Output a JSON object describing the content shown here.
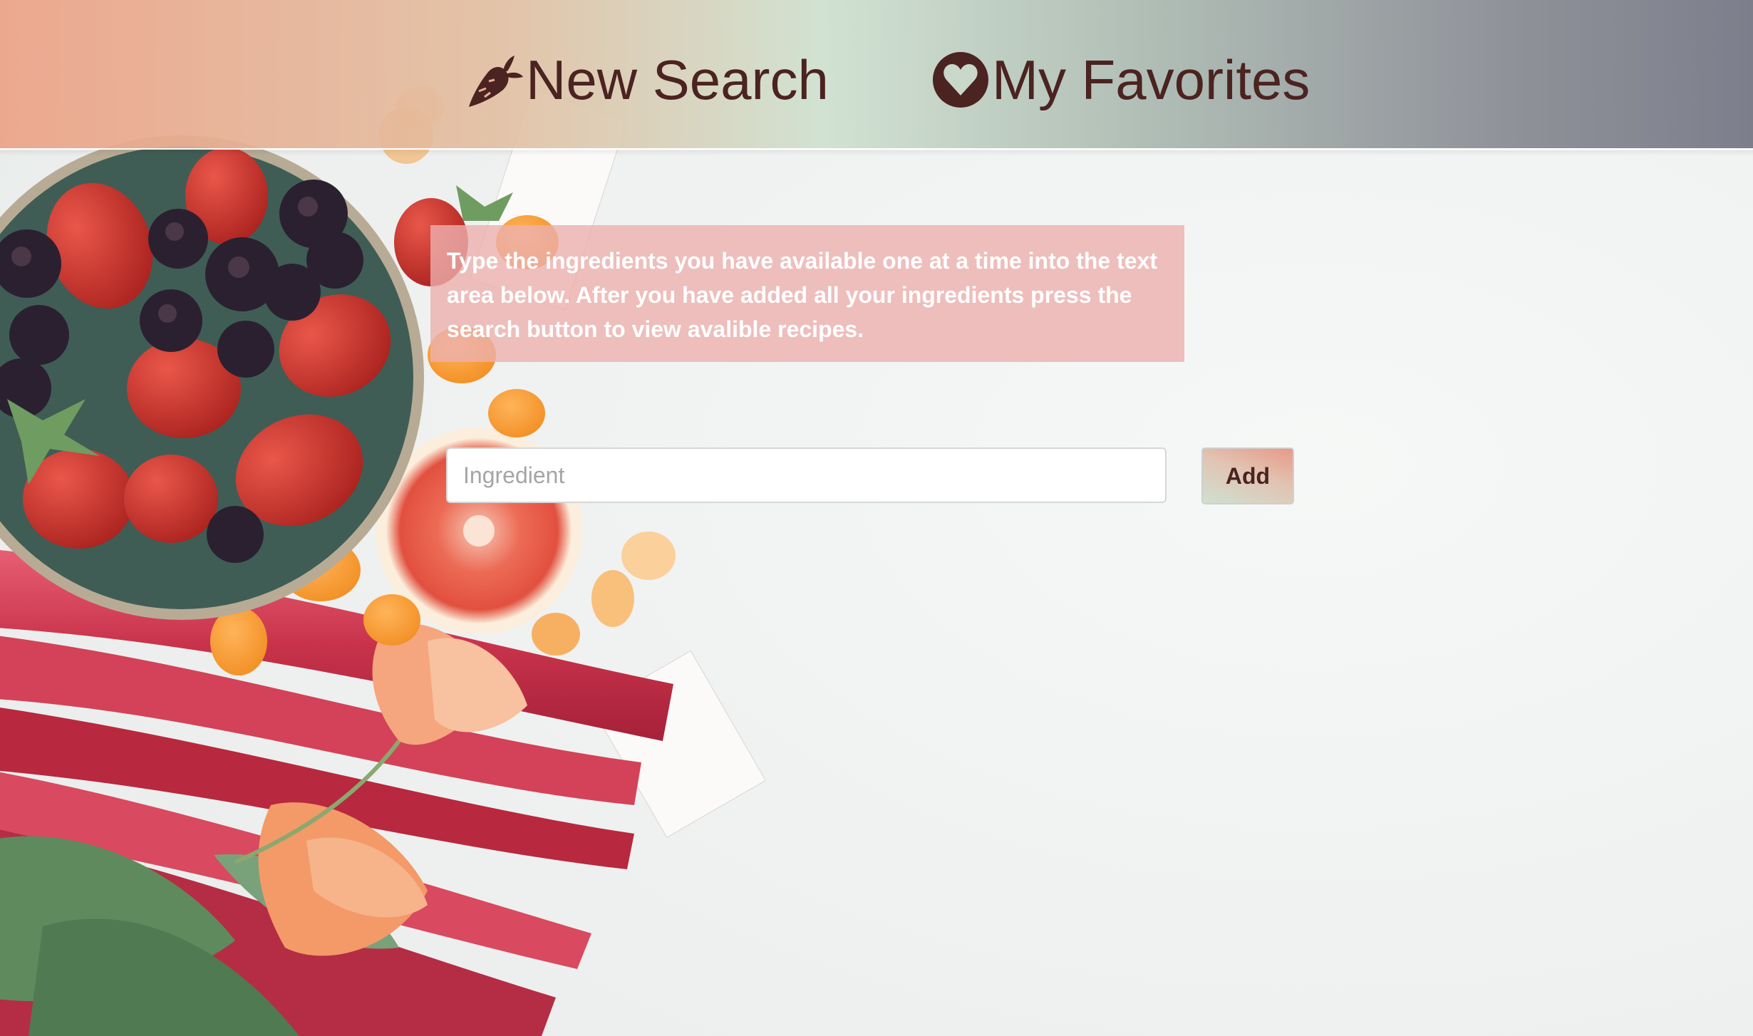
{
  "nav": {
    "new_search": {
      "label": "New Search",
      "icon": "carrot-icon"
    },
    "favorites": {
      "label": "My Favorites",
      "icon": "heart-circle-icon"
    }
  },
  "instructions": {
    "text": "Type the ingredients you have available one at a time into the text area below. After you have added all your ingredients press the search button to view avalible recipes."
  },
  "ingredient_form": {
    "placeholder": "Ingredient",
    "value": "",
    "add_label": "Add"
  },
  "colors": {
    "brand_text": "#4b2320",
    "instructions_bg": "#ecb0ae",
    "header_gradient": [
      "#eca388",
      "#cee0ce",
      "#767886"
    ]
  }
}
